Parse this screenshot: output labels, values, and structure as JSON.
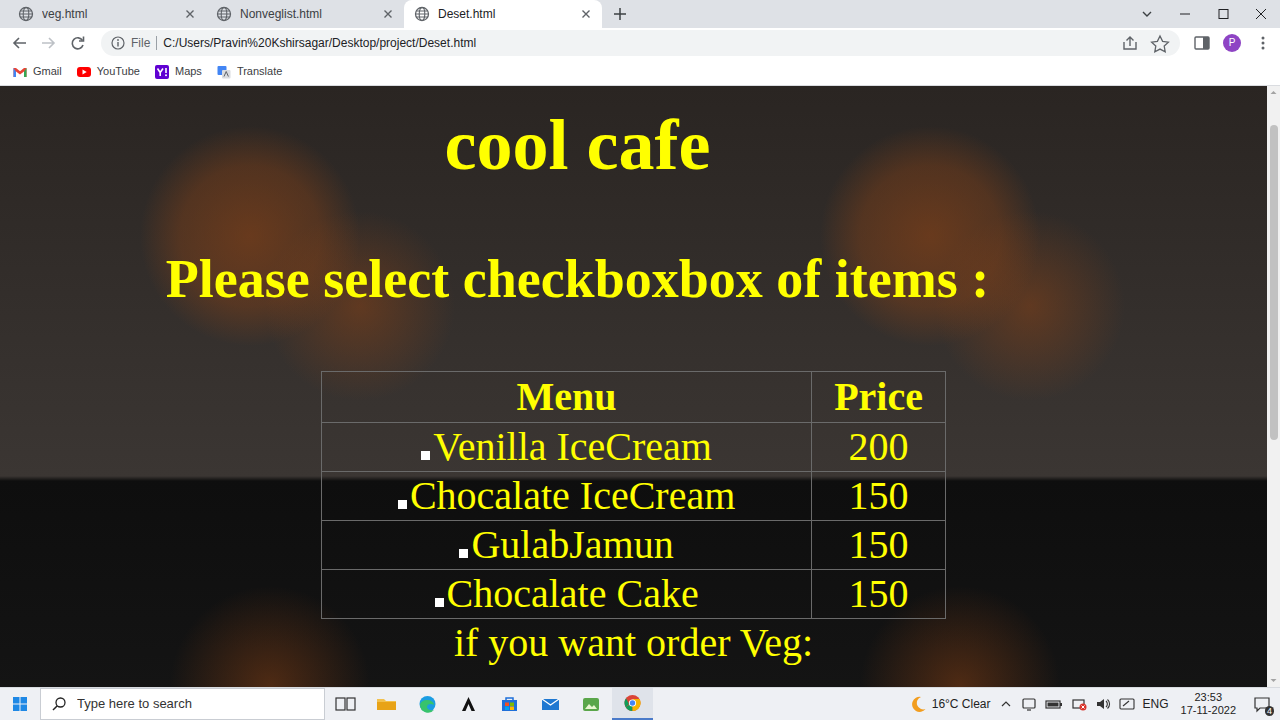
{
  "browser": {
    "tabs": [
      {
        "label": "veg.html",
        "selected": false
      },
      {
        "label": "Nonveglist.html",
        "selected": false
      },
      {
        "label": "Deset.html",
        "selected": true
      }
    ],
    "address": {
      "scheme": "File",
      "url": "C:/Users/Pravin%20Kshirsagar/Desktop/project/Deset.html"
    },
    "profile": "P",
    "bookmarks": [
      "Gmail",
      "YouTube",
      "Maps",
      "Translate"
    ]
  },
  "page": {
    "title": "cool cafe",
    "prompt": "Please select checkboxbox of items :",
    "table": {
      "columns": [
        "Menu",
        "Price"
      ],
      "rows": [
        {
          "item": "Venilla IceCream",
          "price": "200",
          "checked": false
        },
        {
          "item": "Chocalate IceCream",
          "price": "150",
          "checked": false
        },
        {
          "item": "GulabJamun",
          "price": "150",
          "checked": false
        },
        {
          "item": "Chocalate Cake",
          "price": "150",
          "checked": false
        }
      ]
    },
    "footer": "if you want order Veg:"
  },
  "taskbar": {
    "search": {
      "placeholder": "Type here to search"
    },
    "weather": "16°C Clear",
    "language": "ENG",
    "time": "23:53",
    "date": "17-11-2022",
    "notifications": "4"
  }
}
